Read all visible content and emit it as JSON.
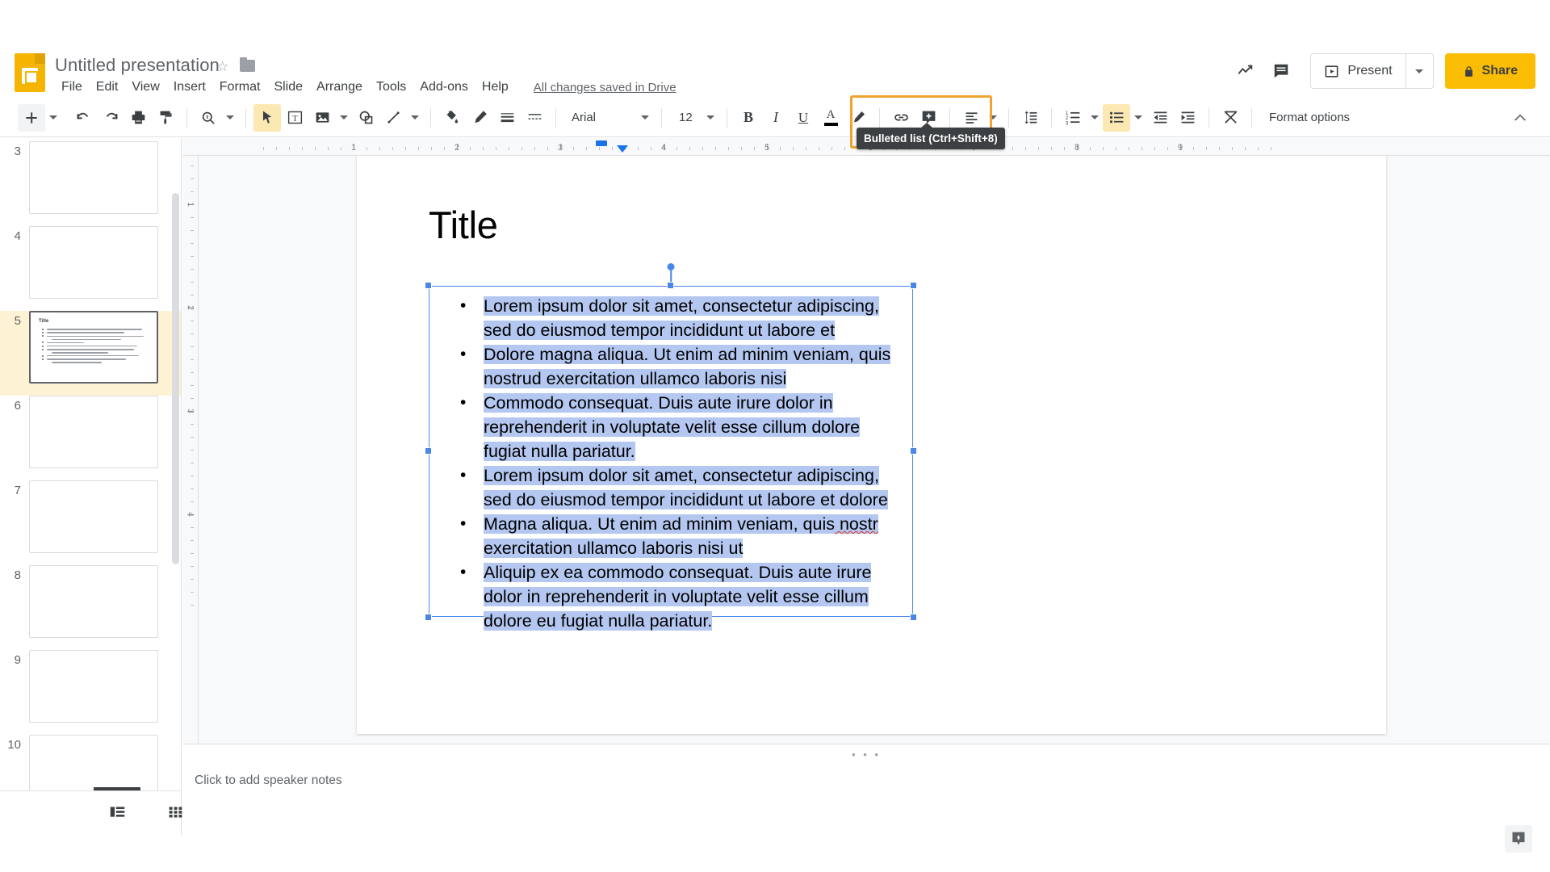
{
  "app": {
    "name": "Google Slides",
    "doc_title": "Untitled presentation",
    "save_status": "All changes saved in Drive"
  },
  "menubar": {
    "items": [
      "File",
      "Edit",
      "View",
      "Insert",
      "Format",
      "Slide",
      "Arrange",
      "Tools",
      "Add-ons",
      "Help"
    ]
  },
  "top_right": {
    "activity_icon": "activity-chart-icon",
    "comments_icon": "comments-icon",
    "present_label": "Present",
    "present_caret": "chevron-down-icon",
    "share_label": "Share",
    "share_lock_icon": "lock-icon",
    "share_color": "#fbbc04"
  },
  "toolbar": {
    "new_slide": "+",
    "undo": "undo-icon",
    "redo": "redo-icon",
    "print": "print-icon",
    "paint_format": "paint-format-icon",
    "zoom": "zoom-icon",
    "select": "select-cursor-icon",
    "textbox": "text-box-icon",
    "image": "image-icon",
    "shape": "shape-icon",
    "line": "line-icon",
    "fill_color": "fill-color-icon",
    "border_color": "border-color-icon",
    "border_weight": "border-weight-icon",
    "border_dash": "border-dash-icon",
    "font_family": "Arial",
    "font_size": "12",
    "bold": "B",
    "italic": "I",
    "underline": "U",
    "text_color": "A",
    "highlight_color": "#f0a32e",
    "insert_link": "link-icon",
    "insert_comment": "add-comment-icon",
    "align": "align-left-icon",
    "line_spacing": "line-spacing-icon",
    "numbered_list": "numbered-list-icon",
    "bulleted_list": "bulleted-list-icon",
    "decrease_indent": "decrease-indent-icon",
    "increase_indent": "increase-indent-icon",
    "clear_formatting": "clear-formatting-icon",
    "format_options_label": "Format options",
    "collapse_icon": "chevron-up-icon"
  },
  "tooltip": {
    "text": "Bulleted list (Ctrl+Shift+8)"
  },
  "filmstrip": {
    "slides": [
      {
        "number": "3",
        "selected": false,
        "has_content": false
      },
      {
        "number": "4",
        "selected": false,
        "has_content": false
      },
      {
        "number": "5",
        "selected": true,
        "has_content": true,
        "thumb_title": "Title"
      },
      {
        "number": "6",
        "selected": false,
        "has_content": false
      },
      {
        "number": "7",
        "selected": false,
        "has_content": false
      },
      {
        "number": "8",
        "selected": false,
        "has_content": false
      },
      {
        "number": "9",
        "selected": false,
        "has_content": false
      },
      {
        "number": "10",
        "selected": false,
        "has_content": false
      }
    ],
    "selected_highlight_color": "#fdf3d4",
    "view_filmstrip_icon": "filmstrip-view-icon",
    "view_grid_icon": "grid-view-icon"
  },
  "ruler": {
    "labels_h": [
      "1",
      "2",
      "3",
      "4",
      "5",
      "6",
      "7",
      "8",
      "9"
    ],
    "labels_v": [
      "1",
      "2",
      "3",
      "4"
    ]
  },
  "slide": {
    "title": "Title",
    "bullets": [
      "Lorem ipsum dolor sit amet, consectetur adipiscing, sed do eiusmod tempor incididunt ut labore et",
      "Dolore magna aliqua. Ut enim ad minim veniam, quis nostrud exercitation ullamco laboris nisi",
      "Commodo consequat. Duis aute irure dolor in reprehenderit in voluptate velit esse cillum dolore fugiat nulla pariatur.",
      "Lorem ipsum dolor sit amet, consectetur adipiscing, sed do eiusmod tempor incididunt ut labore et dolore",
      "Magna aliqua. Ut enim ad minim veniam, quis nostr exercitation ullamco laboris nisi ut",
      "Aliquip ex ea commodo consequat. Duis aute irure dolor in reprehenderit in voluptate velit esse cillum dolore eu fugiat nulla pariatur."
    ],
    "bullet_glyph": "•",
    "selection_color": "#b4c7f0",
    "frame_color": "#4a86e8"
  },
  "notes": {
    "placeholder": "Click to add speaker notes",
    "grip": "• • •"
  },
  "explore": {
    "icon": "explore-icon"
  }
}
